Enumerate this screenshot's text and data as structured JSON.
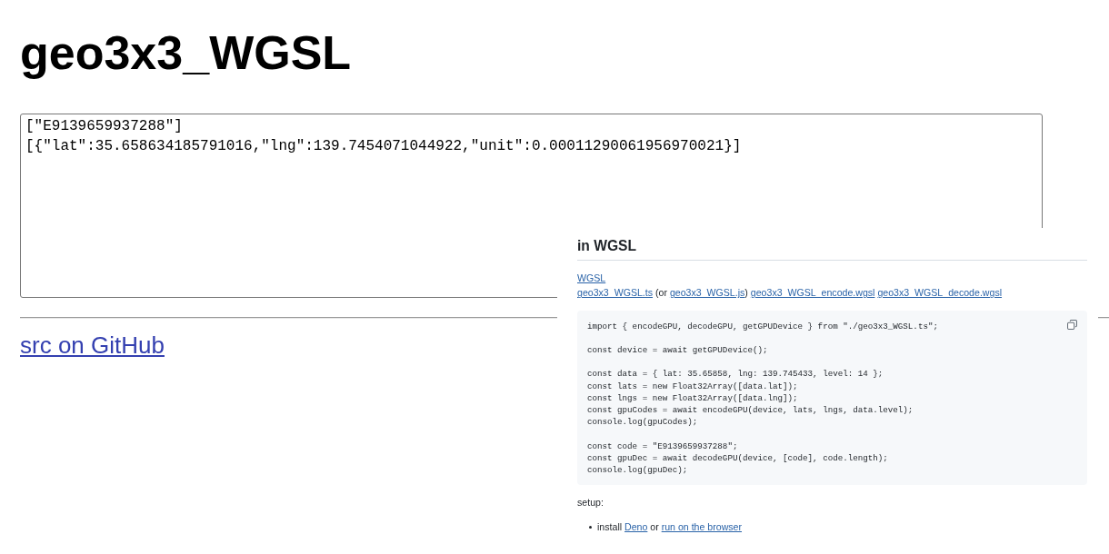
{
  "page": {
    "title": "geo3x3_WGSL",
    "output": {
      "lines": [
        "[\"E9139659937288\"]",
        "[{\"lat\":35.658634185791016,\"lng\":139.7454071044922,\"unit\":0.00011290061956970021}]"
      ]
    },
    "source_link": "src on GitHub"
  },
  "readme_panel": {
    "heading": "in WGSL",
    "link": "WGSL",
    "file_links": [
      {
        "kind": "link",
        "text": "geo3x3_WGSL.ts"
      },
      {
        "kind": "text",
        "text": " (or "
      },
      {
        "kind": "link",
        "text": "geo3x3_WGSL.js"
      },
      {
        "kind": "text",
        "text": ") "
      },
      {
        "kind": "link",
        "text": "geo3x3_WGSL_encode.wgsl"
      },
      {
        "kind": "link",
        "text": "geo3x3_WGSL_decode.wgsl"
      }
    ],
    "code_blocks": [
      [
        "import { encodeGPU, decodeGPU, getGPUDevice } from \"./geo3x3_WGSL.ts\";"
      ],
      [
        "const device = await getGPUDevice();"
      ],
      [
        "const data = { lat: 35.65858, lng: 139.745433, level: 14 };",
        "const lats = new Float32Array([data.lat]);",
        "const lngs = new Float32Array([data.lng]);",
        "const gpuCodes = await encodeGPU(device, lats, lngs, data.level);",
        "console.log(gpuCodes);"
      ],
      [
        "const code = \"E9139659937288\";",
        "const gpuDec = await decodeGPU(device, [code], code.length);",
        "console.log(gpuDec);"
      ]
    ],
    "setup_label": "setup:",
    "setup_items": [
      [
        {
          "kind": "text",
          "text": "install "
        },
        {
          "kind": "link",
          "text": "Deno"
        },
        {
          "kind": "text",
          "text": " or "
        },
        {
          "kind": "link",
          "text": "run on the browser"
        }
      ]
    ]
  }
}
